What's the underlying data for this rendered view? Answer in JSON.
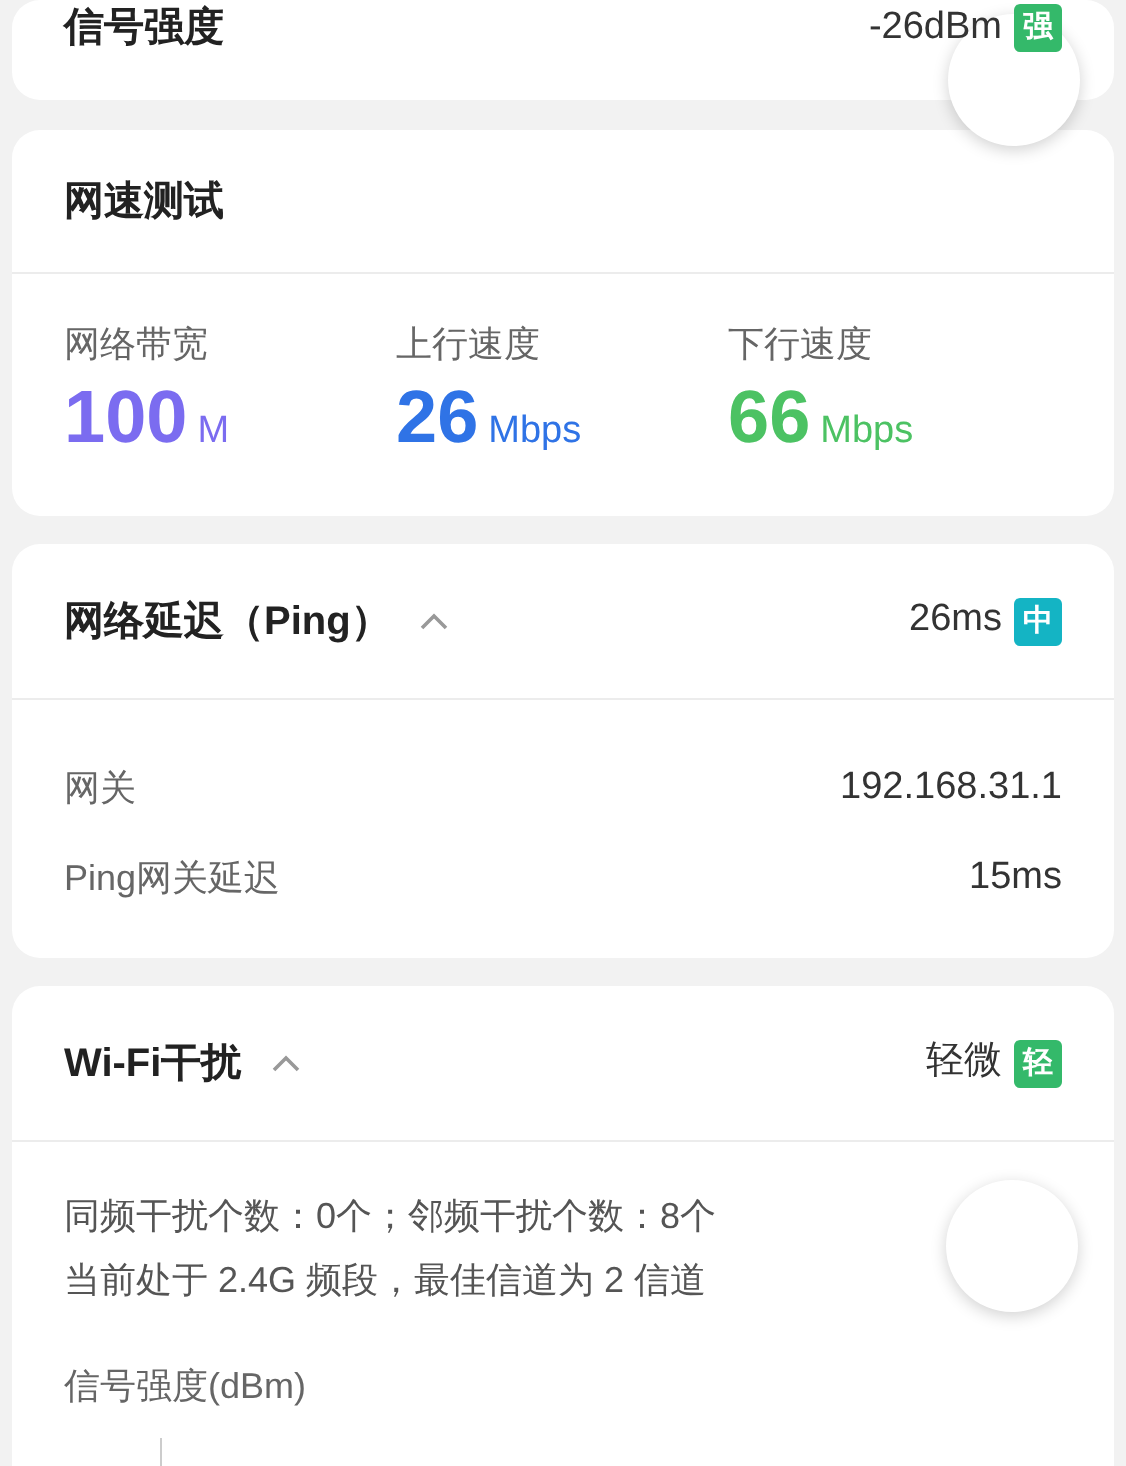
{
  "signal": {
    "label": "信号强度",
    "value": "-26dBm",
    "badge": {
      "text": "强",
      "color": "#34b96a"
    }
  },
  "speed_test": {
    "title": "网速测试",
    "stats": [
      {
        "label": "网络带宽",
        "value": "100",
        "unit": "M",
        "color": "#7b6cf0"
      },
      {
        "label": "上行速度",
        "value": "26",
        "unit": "Mbps",
        "color": "#2f73e6"
      },
      {
        "label": "下行速度",
        "value": "66",
        "unit": "Mbps",
        "color": "#4cc263"
      }
    ]
  },
  "sections": [
    {
      "kind": "rows",
      "title": "网络延迟（Ping）",
      "expanded": true,
      "value": "26ms",
      "badge": {
        "text": "中",
        "color": "#14b4c4"
      },
      "rows": [
        {
          "label": "网关",
          "value": "192.168.31.1"
        },
        {
          "label": "Ping网关延迟",
          "value": "15ms"
        }
      ]
    },
    {
      "kind": "text",
      "title": "Wi-Fi干扰",
      "expanded": true,
      "value": "轻微",
      "badge": {
        "text": "轻",
        "color": "#34b96a"
      },
      "lines": [
        "同频干扰个数：0个；邻频干扰个数：8个",
        "当前处于 2.4G 频段，最佳信道为 2 信道"
      ],
      "chart_label": "信号强度(dBm)"
    }
  ]
}
